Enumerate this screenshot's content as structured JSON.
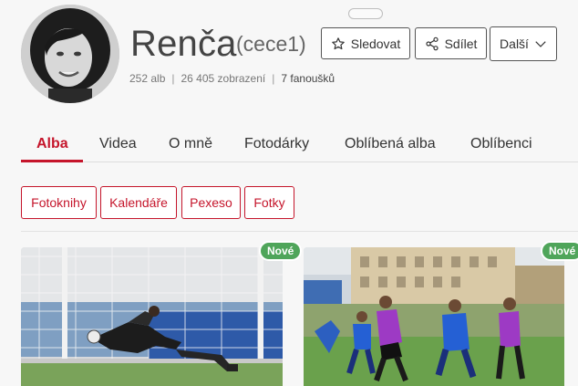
{
  "profile": {
    "name": "Renča",
    "username": "(cece1)",
    "stats": {
      "albums": "252 alb",
      "views": "26 405 zobrazení",
      "fans": "7 fanoušků"
    }
  },
  "actions": {
    "follow": "Sledovat",
    "share": "Sdílet",
    "more": "Další"
  },
  "tabs": [
    {
      "label": "Alba",
      "active": true
    },
    {
      "label": "Videa"
    },
    {
      "label": "O mně"
    },
    {
      "label": "Fotodárky"
    },
    {
      "label": "Oblíbená alba"
    },
    {
      "label": "Oblíbenci"
    }
  ],
  "product_chips": [
    "Fotoknihy",
    "Kalendáře",
    "Pexeso",
    "Fotky"
  ],
  "albums": [
    {
      "badge": "Nové",
      "image": "goalkeeper-diving-photo"
    },
    {
      "badge": "Nové",
      "image": "youth-football-match-photo"
    }
  ],
  "colors": {
    "accent": "#c5152b",
    "badge": "#4fa55a"
  }
}
